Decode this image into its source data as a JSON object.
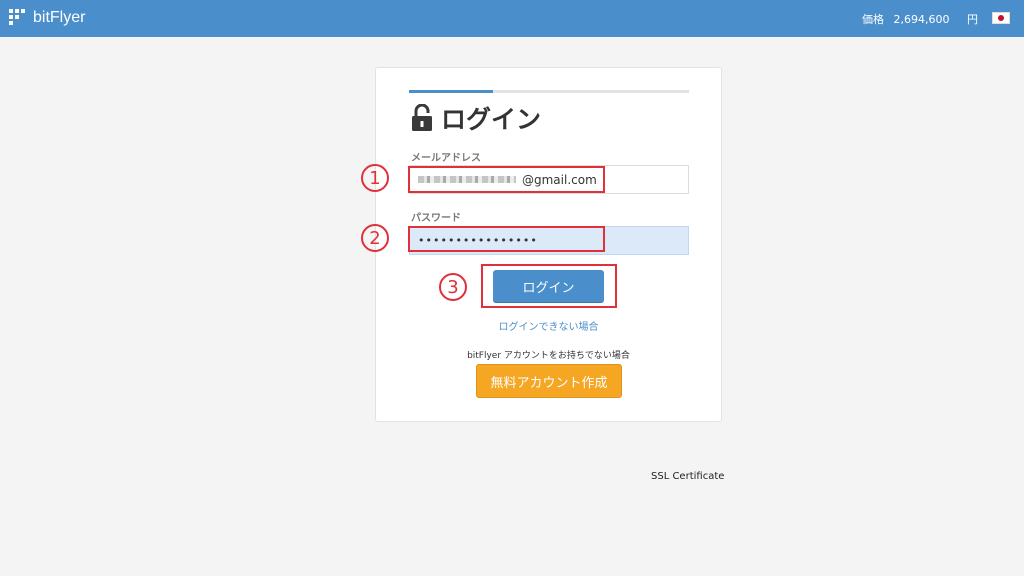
{
  "header": {
    "logo_text": "bitFlyer",
    "price_label": "価格",
    "price_value": "2,694,600",
    "price_unit": "円",
    "flag_icon": "japan-flag-icon",
    "background_color": "#4a8fcc"
  },
  "login": {
    "progress_fraction": 0.3,
    "title": "ログイン",
    "email_label": "メールアドレス",
    "email_value": "@gmail.com",
    "password_label": "パスワード",
    "password_value": "••••••••••••••••",
    "login_button": "ログイン",
    "forgot_link": "ログインできない場合",
    "no_account_text": "bitFlyer アカウントをお持ちでない場合",
    "signup_button": "無料アカウント作成"
  },
  "annotations": {
    "step1": "1",
    "step2": "2",
    "step3": "3",
    "color": "#e0303a"
  },
  "footer": {
    "ssl": "SSL Certificate"
  }
}
